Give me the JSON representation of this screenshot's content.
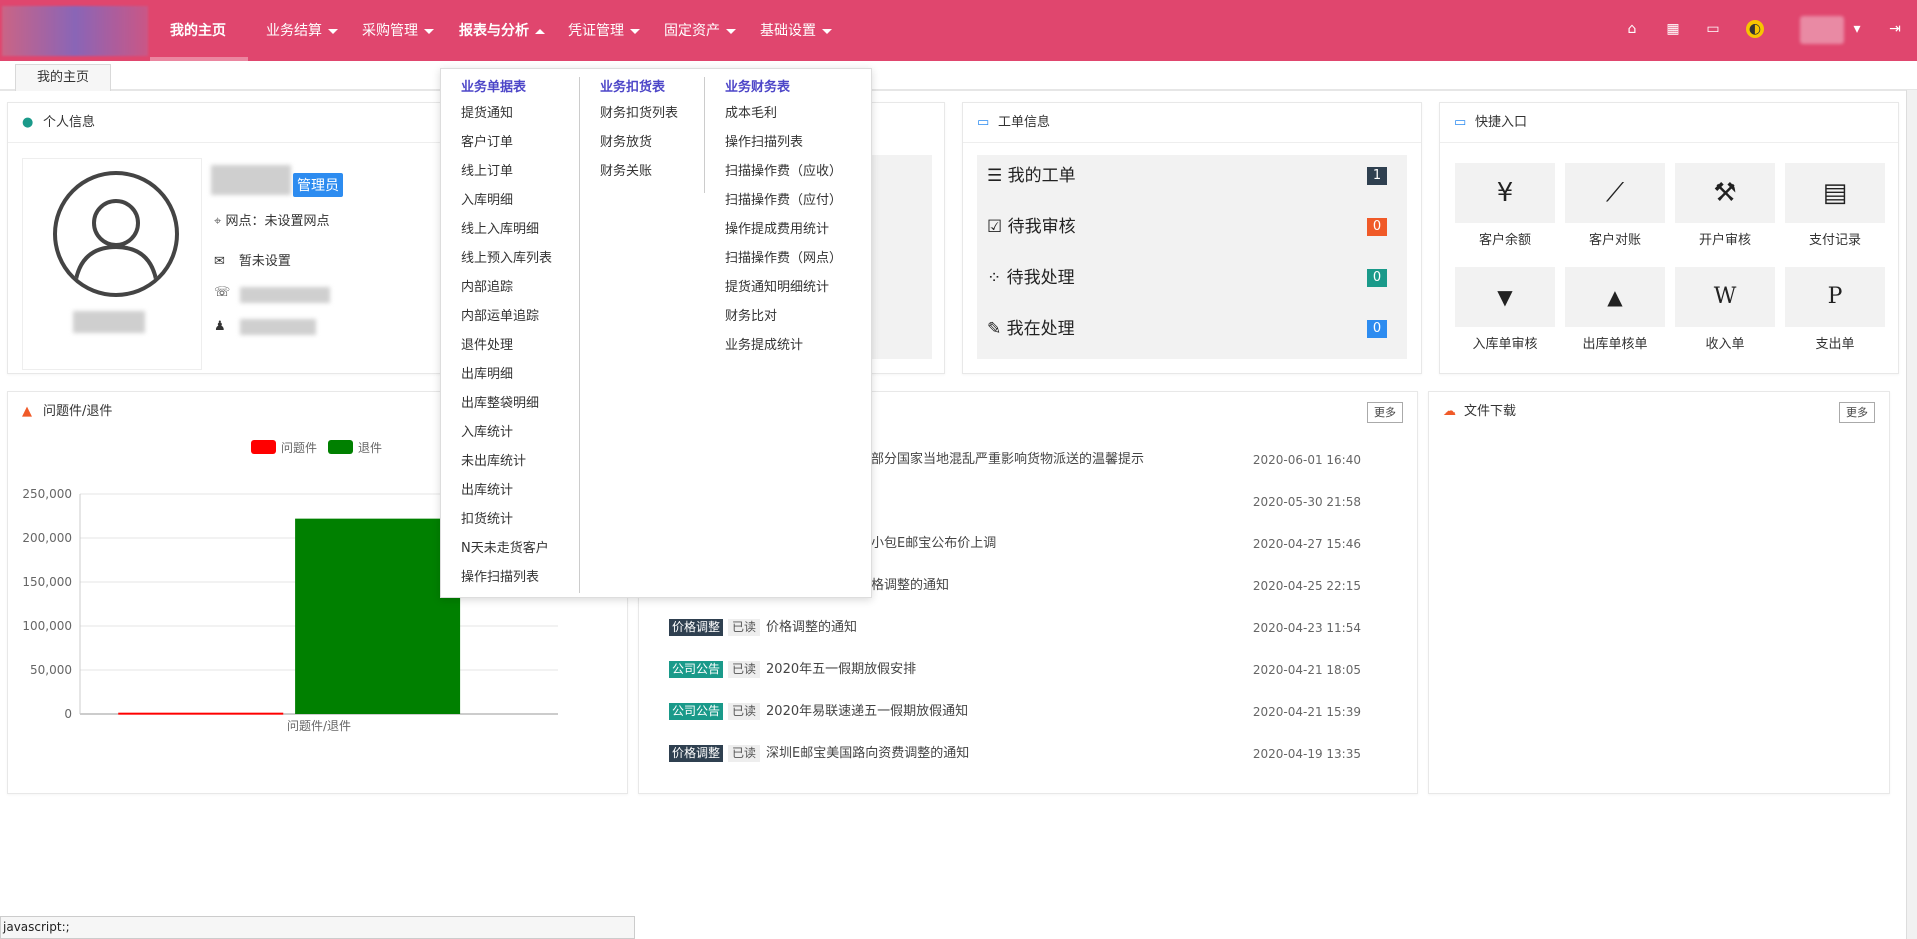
{
  "nav": {
    "items": [
      {
        "label": "我的主页",
        "caret": false
      },
      {
        "label": "业务结算",
        "caret": true
      },
      {
        "label": "采购管理",
        "caret": true
      },
      {
        "label": "报表与分析",
        "caret": true
      },
      {
        "label": "凭证管理",
        "caret": true
      },
      {
        "label": "固定资产",
        "caret": true
      },
      {
        "label": "基础设置",
        "caret": true
      }
    ],
    "accent": "#e0466e"
  },
  "tabs": {
    "home": "我的主页"
  },
  "personal": {
    "title": "个人信息",
    "role_badge": "管理员",
    "site_label": "网点：",
    "site_value": "未设置网点",
    "email_value": "暂未设置"
  },
  "problem": {
    "title": "问题件/退件"
  },
  "workorder": {
    "title": "工单信息",
    "rows": [
      {
        "label": "我的工单",
        "count": "1",
        "color": "#2f4050"
      },
      {
        "label": "待我审核",
        "count": "0",
        "color": "#f05a28"
      },
      {
        "label": "待我处理",
        "count": "0",
        "color": "#1a9a8a"
      },
      {
        "label": "我在处理",
        "count": "0",
        "color": "#2d8cf0"
      }
    ]
  },
  "quick": {
    "title": "快捷入口",
    "items": [
      {
        "label": "客户余额",
        "icon": "yen-icon",
        "glyph": "¥"
      },
      {
        "label": "客户对账",
        "icon": "line-chart-icon",
        "glyph": "⟋"
      },
      {
        "label": "开户审核",
        "icon": "gavel-icon",
        "glyph": "⚒"
      },
      {
        "label": "支付记录",
        "icon": "document-icon",
        "glyph": "▤"
      },
      {
        "label": "入库单审核",
        "icon": "down-square-icon",
        "glyph": "▼"
      },
      {
        "label": "出库单核单",
        "icon": "up-square-icon",
        "glyph": "▲"
      },
      {
        "label": "收入单",
        "icon": "word-file-icon",
        "glyph": "W"
      },
      {
        "label": "支出单",
        "icon": "p-file-icon",
        "glyph": "P"
      }
    ]
  },
  "news": {
    "more": "更多",
    "rows": [
      {
        "tag": "",
        "read": "",
        "title": "部分国家当地混乱严重影响货物派送的温馨提示",
        "date": "2020-06-01 16:40"
      },
      {
        "tag": "",
        "read": "",
        "title": "",
        "date": "2020-05-30 21:58"
      },
      {
        "tag": "",
        "read": "",
        "title": "小包E邮宝公布价上调",
        "date": "2020-04-27 15:46"
      },
      {
        "tag": "",
        "read": "",
        "title": "格调整的通知",
        "date": "2020-04-25 22:15"
      },
      {
        "tag": "价格调整",
        "tagColor": "#2f4050",
        "read": "已读",
        "title": "价格调整的通知",
        "date": "2020-04-23 11:54"
      },
      {
        "tag": "公司公告",
        "tagColor": "#1a9a8a",
        "read": "已读",
        "title": "2020年五一假期放假安排",
        "date": "2020-04-21 18:05"
      },
      {
        "tag": "公司公告",
        "tagColor": "#1a9a8a",
        "read": "已读",
        "title": "2020年易联速递五一假期放假通知",
        "date": "2020-04-21 15:39"
      },
      {
        "tag": "价格调整",
        "tagColor": "#2f4050",
        "read": "已读",
        "title": "深圳E邮宝美国路向资费调整的通知",
        "date": "2020-04-19 13:35"
      }
    ]
  },
  "files": {
    "title": "文件下载",
    "more": "更多"
  },
  "dropdown": {
    "col1": {
      "head": "业务单据表",
      "items": [
        "提货通知",
        "客户订单",
        "线上订单",
        "入库明细",
        "线上入库明细",
        "线上预入库列表",
        "内部追踪",
        "内部运单追踪",
        "退件处理",
        "出库明细",
        "出库整袋明细",
        "入库统计",
        "未出库统计",
        "出库统计",
        "扣货统计",
        "N天未走货客户",
        "操作扫描列表"
      ]
    },
    "col2": {
      "head": "业务扣货表",
      "items": [
        "财务扣货列表",
        "财务放货",
        "财务关账"
      ]
    },
    "col3": {
      "head": "业务财务表",
      "items": [
        "成本毛利",
        "操作扫描列表",
        "扫描操作费（应收）",
        "扫描操作费（应付）",
        "操作提成费用统计",
        "扫描操作费（网点）",
        "提货通知明细统计",
        "财务比对",
        "业务提成统计"
      ]
    }
  },
  "chart_data": {
    "type": "bar",
    "categories": [
      "问题件/退件"
    ],
    "series": [
      {
        "name": "问题件",
        "values": [
          1500
        ],
        "color": "#ff0000"
      },
      {
        "name": "退件",
        "values": [
          222000
        ],
        "color": "#008000"
      }
    ],
    "xlabel": "",
    "ylabel": "",
    "yticks": [
      "0",
      "50,000",
      "100,000",
      "150,000",
      "200,000",
      "250,000"
    ],
    "ylim": [
      0,
      250000
    ],
    "grid": true,
    "legend": "top"
  },
  "status": {
    "text": "javascript:;"
  }
}
